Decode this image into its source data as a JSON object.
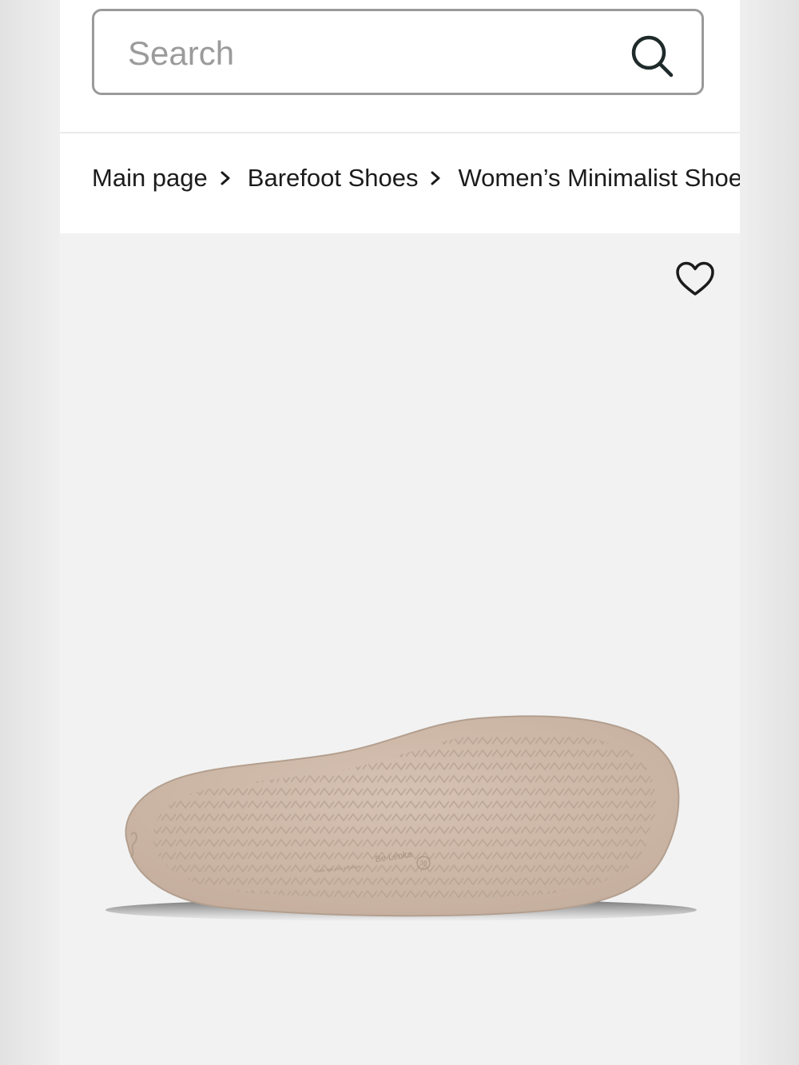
{
  "search": {
    "placeholder": "Search",
    "value": ""
  },
  "breadcrumb": {
    "items": [
      {
        "label": "Main page"
      },
      {
        "label": "Barefoot Shoes"
      },
      {
        "label": "Women’s Minimalist Shoes"
      }
    ]
  },
  "product": {
    "sole_brand": "Be Lenka",
    "sole_size": "38",
    "sole_tiny_text": "Made with care in Europe"
  },
  "icons": {
    "search": "search-icon",
    "chevron": "chevron-right-icon",
    "favorite": "heart-icon"
  },
  "colors": {
    "sole": "#cdb7a7",
    "sole_dark": "#b39f8f",
    "border": "#9a9a9a",
    "text": "#1b1b1b",
    "background": "#f2f2f2"
  }
}
